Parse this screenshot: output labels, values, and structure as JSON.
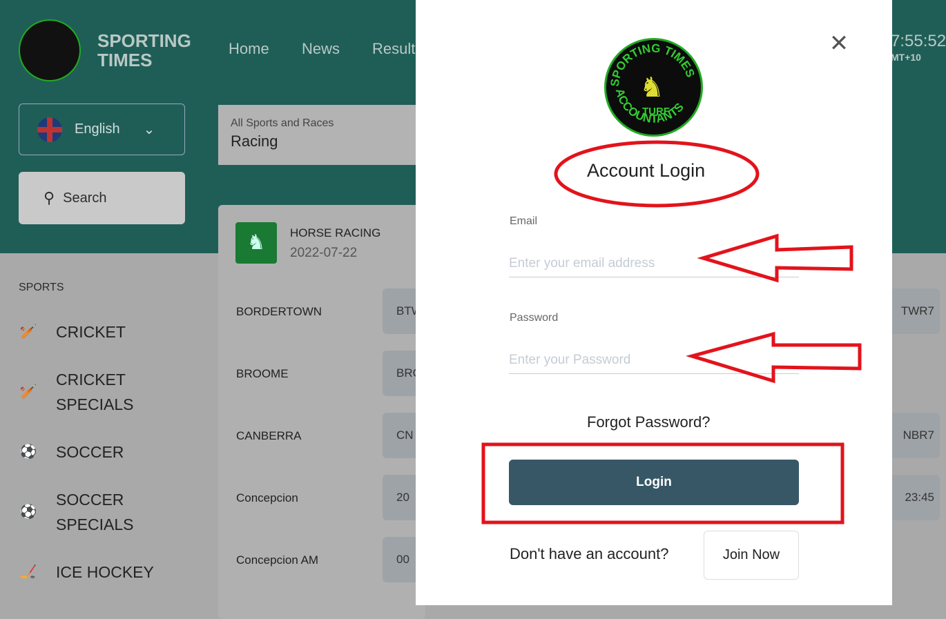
{
  "header": {
    "brand_line1": "SPORTING",
    "brand_line2": "TIMES",
    "nav": [
      "Home",
      "News",
      "Result"
    ],
    "clock": "7:55:52",
    "timezone": "MT+10"
  },
  "language": {
    "selected": "English",
    "icon": "uk-flag-icon"
  },
  "search": {
    "label": "Search"
  },
  "filter": {
    "label": "All Sports and Races",
    "value": "Racing"
  },
  "sidebar": {
    "heading": "SPORTS",
    "items": [
      {
        "label1": "CRICKET",
        "label2": "",
        "icon": "cricket-icon"
      },
      {
        "label1": "CRICKET",
        "label2": "SPECIALS",
        "icon": "cricket-icon"
      },
      {
        "label1": "SOCCER",
        "label2": "",
        "icon": "soccer-ball-icon"
      },
      {
        "label1": "SOCCER",
        "label2": "SPECIALS",
        "icon": "soccer-ball-icon"
      },
      {
        "label1": "ICE HOCKEY",
        "label2": "",
        "icon": "hockey-sticks-icon"
      }
    ]
  },
  "racing": {
    "title": "HORSE RACING",
    "date": "2022-07-22",
    "rows": [
      {
        "track": "BORDERTOWN",
        "code": "BTW",
        "right": "TWR7"
      },
      {
        "track": "BROOME",
        "code": "BRO",
        "right": ""
      },
      {
        "track": "CANBERRA",
        "code": "CN",
        "right": "NBR7"
      },
      {
        "track": "Concepcion",
        "code": "20",
        "right": "23:45"
      },
      {
        "track": "Concepcion AM",
        "code": "00",
        "right": ""
      }
    ]
  },
  "modal": {
    "logo_text": "SPORTING TIMES TURF ACCOUNTANTS",
    "title": "Account Login",
    "email_label": "Email",
    "email_placeholder": "Enter your email address",
    "password_label": "Password",
    "password_placeholder": "Enter your Password",
    "forgot": "Forgot Password?",
    "login": "Login",
    "no_account": "Don't have an account?",
    "join": "Join Now"
  },
  "annotation_color": "#e3131b"
}
